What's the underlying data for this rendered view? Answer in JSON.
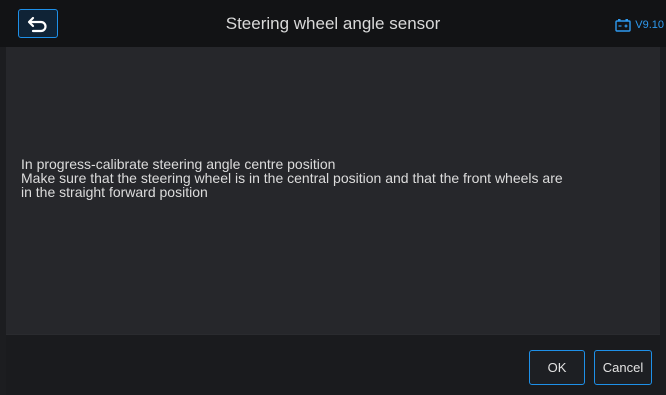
{
  "header": {
    "title": "Steering wheel angle sensor",
    "version": "V9.10",
    "back_icon": "back-arrow-icon",
    "battery_icon": "battery-icon"
  },
  "message": {
    "lines": [
      "In progress-calibrate steering angle centre position",
      "Make sure that the steering wheel is in the central position and that the front wheels are",
      "in the straight forward position"
    ]
  },
  "footer": {
    "ok_label": "OK",
    "cancel_label": "Cancel"
  },
  "colors": {
    "accent": "#1e90e8",
    "background": "#1c1d20",
    "content_bg": "#26272b",
    "text": "#dcdcdc"
  }
}
